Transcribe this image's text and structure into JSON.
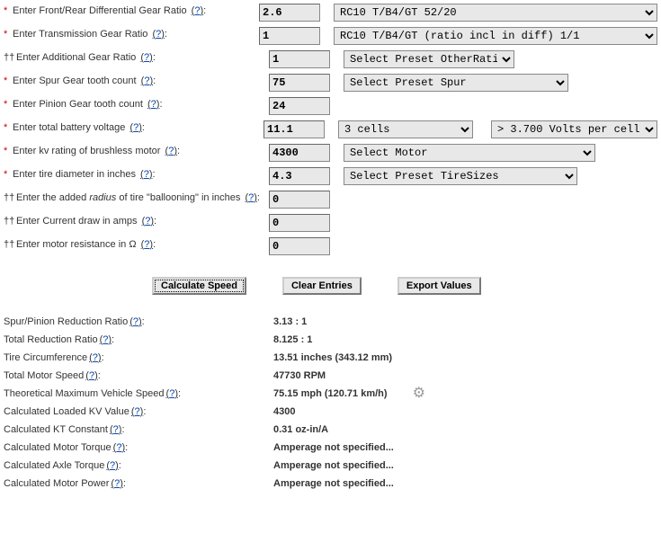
{
  "inputs": {
    "diff_ratio": {
      "label": "Enter Front/Rear Differential Gear Ratio",
      "value": "2.6",
      "preset": "RC10 T/B4/GT                       52/20"
    },
    "trans_ratio": {
      "label": "Enter Transmission Gear Ratio",
      "value": "1",
      "preset": "RC10 T/B4/GT (ratio incl in diff)          1/1"
    },
    "addl_ratio": {
      "label": "Enter Additional Gear Ratio",
      "value": "1",
      "preset": "Select Preset OtherRatio"
    },
    "spur": {
      "label": "Enter Spur Gear tooth count",
      "value": "75",
      "preset": "Select Preset Spur"
    },
    "pinion": {
      "label": "Enter Pinion Gear tooth count",
      "value": "24"
    },
    "voltage": {
      "label": "Enter total battery voltage",
      "value": "11.1",
      "preset_cells": "3 cells",
      "preset_vpc": "> 3.700 Volts per cell"
    },
    "kv": {
      "label": "Enter kv rating of brushless motor",
      "value": "4300",
      "preset": "Select Motor"
    },
    "tire_dia": {
      "label": "Enter tire diameter in inches",
      "value": "4.3",
      "preset": "Select Preset TireSizes"
    },
    "balloon": {
      "label_pre": "Enter the added ",
      "label_em": "radius",
      "label_post": " of tire \"ballooning\" in inches",
      "value": "0"
    },
    "current": {
      "label": "Enter Current draw in amps",
      "value": "0"
    },
    "resistance": {
      "label": "Enter motor resistance in Ω",
      "value": "0"
    }
  },
  "buttons": {
    "calc": "Calculate Speed",
    "clear": "Clear Entries",
    "export": "Export Values"
  },
  "results": {
    "spur_pinion": {
      "label": "Spur/Pinion Reduction Ratio",
      "value": "3.13 : 1"
    },
    "total_red": {
      "label": "Total Reduction Ratio",
      "value": "8.125 : 1"
    },
    "circ": {
      "label": "Tire Circumference",
      "value": "13.51 inches (343.12 mm)"
    },
    "rpm": {
      "label": "Total Motor Speed",
      "value": "47730 RPM"
    },
    "max_speed": {
      "label": "Theoretical Maximum Vehicle Speed",
      "value": "75.15 mph (120.71 km/h)"
    },
    "loaded_kv": {
      "label": "Calculated Loaded KV Value",
      "value": "4300"
    },
    "kt": {
      "label": "Calculated KT Constant",
      "value": "0.31 oz-in/A"
    },
    "motor_tq": {
      "label": "Calculated Motor Torque",
      "value": "Amperage not specified..."
    },
    "axle_tq": {
      "label": "Calculated Axle Torque",
      "value": "Amperage not specified..."
    },
    "motor_pw": {
      "label": "Calculated Motor Power",
      "value": "Amperage not specified..."
    }
  },
  "help_char": "?"
}
